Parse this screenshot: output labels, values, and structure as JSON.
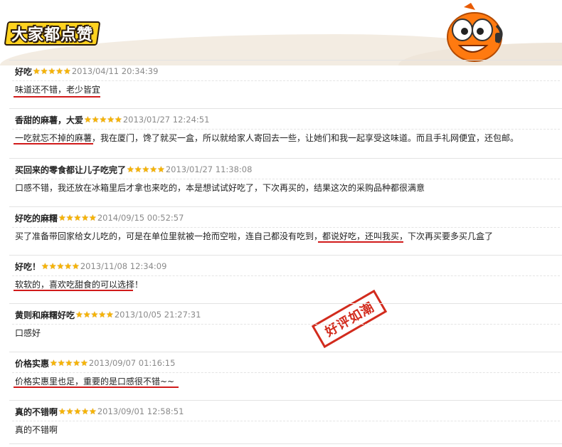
{
  "header": {
    "title": "大家都点赞"
  },
  "stamp_text": "好评如潮",
  "reviews": [
    {
      "title": "好吃",
      "stars": "★★★★★",
      "date": "2013/04/11 20:34:39",
      "text": "味道还不错，老少皆宜"
    },
    {
      "title": "香甜的麻薯，大爱",
      "stars": "★★★★★",
      "date": "2013/01/27 12:24:51",
      "text": "一吃就忘不掉的麻薯，我在厦门，馋了就买一盒，所以就给家人寄回去一些，让她们和我一起享受这味道。而且手礼网便宜，还包邮。"
    },
    {
      "title": "买回来的零食都让儿子吃完了",
      "stars": "★★★★★",
      "date": "2013/01/27 11:38:08",
      "text": "口感不错，我还放在冰箱里后才拿也来吃的，本是想试试好吃了，下次再买的，结果这次的采购品种都很满意"
    },
    {
      "title": "好吃的麻糬",
      "stars": "★★★★★",
      "date": "2014/09/15 00:52:57",
      "text": "买了准备带回家给女儿吃的，可是在单位里就被一抢而空啦，连自己都没有吃到，都说好吃，还叫我买，下次再买要多买几盒了"
    },
    {
      "title": "好吃！",
      "stars": "★★★★★",
      "date": "2013/11/08 12:34:09",
      "text": "软软的，喜欢吃甜食的可以选择！"
    },
    {
      "title": "黄则和麻糬好吃",
      "stars": "★★★★★",
      "date": "2013/10/05 21:27:31",
      "text": "口感好"
    },
    {
      "title": "价格实惠",
      "stars": "★★★★★",
      "date": "2013/09/07 01:16:15",
      "text": "价格实惠里也足，重要的是口感很不错~~"
    },
    {
      "title": "真的不错啊",
      "stars": "★★★★★",
      "date": "2013/09/01 12:58:51",
      "text": "真的不错啊"
    }
  ],
  "colors": {
    "accent": "#d11b1b",
    "star": "#f6b400",
    "brand": "#ffd21f"
  }
}
